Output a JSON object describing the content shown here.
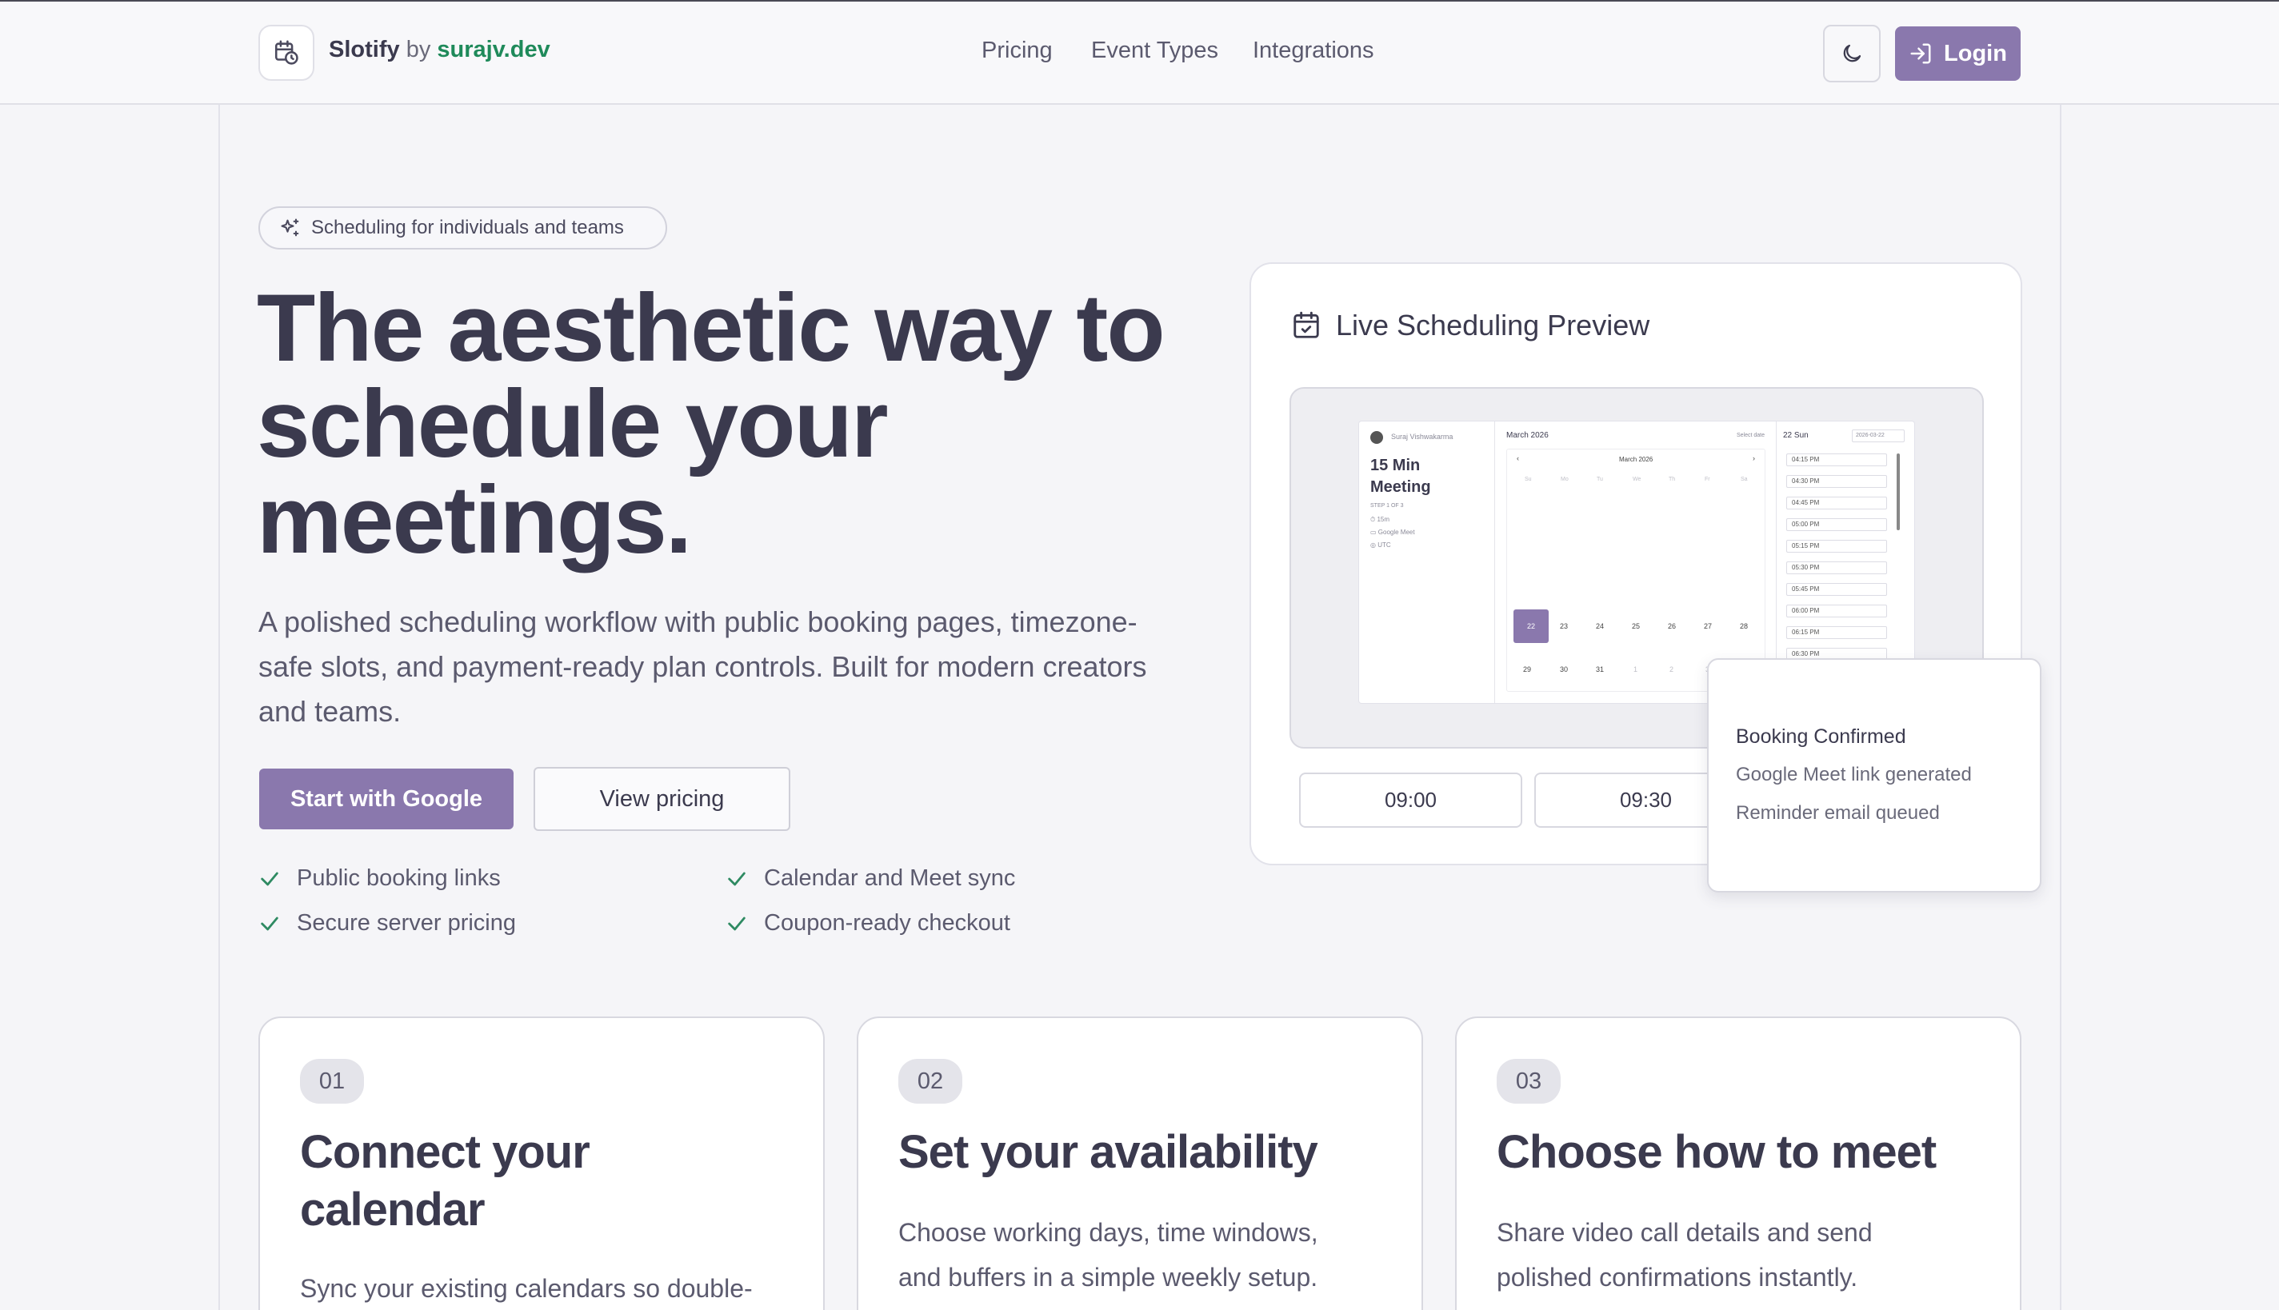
{
  "header": {
    "brand_name": "Slotify",
    "brand_by": "by",
    "brand_site": "surajv.dev",
    "nav": [
      "Pricing",
      "Event Types",
      "Integrations"
    ],
    "login_label": "Login"
  },
  "hero": {
    "badge": "Scheduling for individuals and teams",
    "title_lines": [
      "The aesthetic way to",
      "schedule your",
      "meetings."
    ],
    "subtitle_lines": [
      "A polished scheduling workflow with public booking pages, timezone-",
      "safe slots, and payment-ready plan controls. Built for modern creators",
      "and teams."
    ],
    "primary_cta": "Start with Google",
    "secondary_cta": "View pricing",
    "features": [
      "Public booking links",
      "Calendar and Meet sync",
      "Secure server pricing",
      "Coupon-ready checkout"
    ]
  },
  "preview": {
    "title": "Live Scheduling Preview",
    "mini": {
      "host": "Suraj Vishwakarma",
      "meeting_title": [
        "15 Min",
        "Meeting"
      ],
      "step": "STEP 1 OF 3",
      "details": [
        "15m",
        "Google Meet",
        "UTC"
      ],
      "month_header": "March 2026",
      "select_date": "Select date",
      "calendar_month": "March 2026",
      "weekdays": [
        "Su",
        "Mo",
        "Tu",
        "We",
        "Th",
        "Fr",
        "Sa"
      ],
      "week_row": [
        "22",
        "23",
        "24",
        "25",
        "26",
        "27",
        "28"
      ],
      "last_row": [
        "29",
        "30",
        "31",
        "1",
        "2",
        "3"
      ],
      "selected_day": "22 Sun",
      "date_input": "2026-03-22",
      "slots": [
        "04:15 PM",
        "04:30 PM",
        "04:45 PM",
        "05:00 PM",
        "05:15 PM",
        "05:30 PM",
        "05:45 PM",
        "06:00 PM",
        "06:15 PM",
        "06:30 PM"
      ],
      "slot_duration": "15m"
    },
    "times": [
      "09:00",
      "09:30"
    ]
  },
  "confirmation": {
    "title": "Booking Confirmed",
    "lines": [
      "Google Meet link generated",
      "Reminder email queued"
    ]
  },
  "steps": [
    {
      "num": "01",
      "title": [
        "Connect your",
        "calendar"
      ],
      "desc": [
        "Sync your existing calendars so double-"
      ]
    },
    {
      "num": "02",
      "title": [
        "Set your availability"
      ],
      "desc": [
        "Choose working days, time windows,",
        "and buffers in a simple weekly setup."
      ]
    },
    {
      "num": "03",
      "title": [
        "Choose how to meet"
      ],
      "desc": [
        "Share video call details and send",
        "polished confirmations instantly."
      ]
    }
  ],
  "colors": {
    "accent": "#8a78ad",
    "brand_green": "#1f8a5a",
    "check_green": "#2e8a62"
  }
}
